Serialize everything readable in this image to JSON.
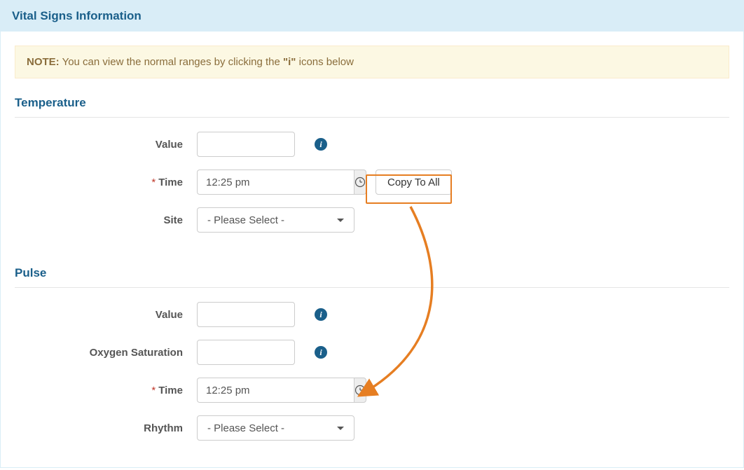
{
  "header": {
    "title": "Vital Signs Information"
  },
  "note": {
    "bold": "NOTE:",
    "text_before": " You can view the normal ranges by clicking the ",
    "quoted": "\"i\"",
    "text_after": " icons below"
  },
  "temperature": {
    "title": "Temperature",
    "value_label": "Value",
    "value": "",
    "time_label": "Time",
    "time_value": "12:25 pm",
    "copy_button": "Copy To All",
    "site_label": "Site",
    "site_selected": "- Please Select -"
  },
  "pulse": {
    "title": "Pulse",
    "value_label": "Value",
    "value": "",
    "oxy_label": "Oxygen Saturation",
    "oxy_value": "",
    "time_label": "Time",
    "time_value": "12:25 pm",
    "rhythm_label": "Rhythm",
    "rhythm_selected": "- Please Select -"
  },
  "icons": {
    "info": "i"
  }
}
